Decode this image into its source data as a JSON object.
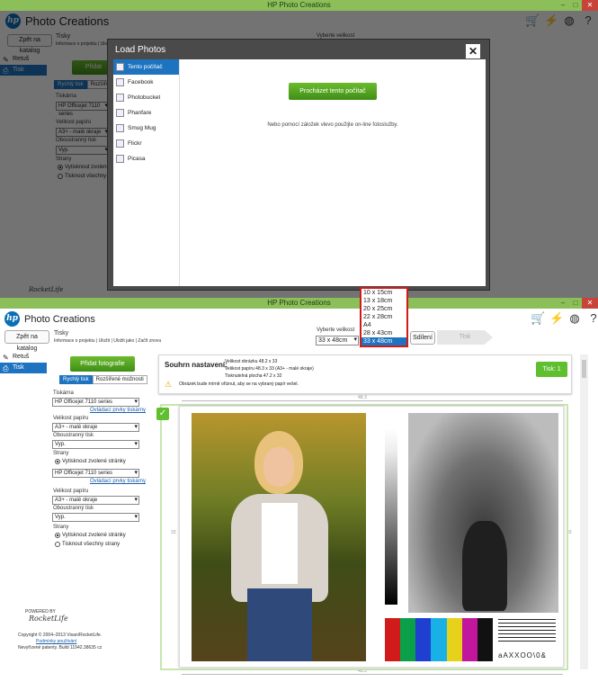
{
  "window_title": "HP Photo Creations",
  "app_name": "Photo Creations",
  "hp_logo": "hp",
  "back_button": "Zpět na katalog",
  "project": {
    "name": "Tisky",
    "links": [
      "Informace o projektu",
      "Uložit",
      "Uložit jako",
      "Začít znovu"
    ]
  },
  "sidebar": [
    {
      "label": "Retuš",
      "icon": "pencil-icon"
    },
    {
      "label": "Tisk",
      "icon": "printer-icon"
    }
  ],
  "add_photo": "Přidat fotografie",
  "tabs": {
    "quick": "Rychlý tisk",
    "advanced": "Rozšířené možnosti"
  },
  "printer": {
    "label": "Tiskárna",
    "value": "HP Officejet 7110 series",
    "link": "Ovládací prvky tiskárny"
  },
  "paper": {
    "label": "Velikost papíru",
    "value": "A3+ - malé okraje"
  },
  "duplex": {
    "label": "Oboustranný tisk",
    "value": "Vyp."
  },
  "pages": {
    "label": "Strany",
    "opt1": "Vytisknout zvolené stránky",
    "opt2": "Tisknout všechny strany"
  },
  "size": {
    "label": "Vyberte velikost",
    "value": "33 x 48cm",
    "options": [
      "10 x 15cm",
      "13 x 18cm",
      "20 x 25cm",
      "22 x 28cm",
      "A4",
      "28 x 43cm",
      "33 x 48cm"
    ],
    "selected_index": 6
  },
  "share_button": "Sdílení",
  "print_button": "Tisk",
  "summary": {
    "title": "Souhrn nastavení:",
    "line1": "Velikost obrázku 48.2 x 33",
    "line2": "Velikost papíru 48.3 x 33 (A3+ - malé okraje)",
    "line3": "Tisknutelná plocha 47.2 x 32",
    "warning": "Obrázek bude mírně oříznut, aby se na vybraný papír vešel."
  },
  "print_count": "Tisk: 1",
  "dims": {
    "width": "48.3",
    "height": "33"
  },
  "footer": {
    "copyright": "Copyright © 2004–2013 Visan/RocketLife.",
    "terms": "Podmínky používání",
    "patents": "Nevyřízené patenty. Build 11942.38635 cz"
  },
  "brand": "RocketLife",
  "brand_note": "POWERED BY",
  "test_chart": {
    "text": "aAXXOO\\0&",
    "colors": [
      "#d11a1a",
      "#0aa04a",
      "#1f3fd1",
      "#19b0e6",
      "#e6d21a",
      "#c2169c",
      "#111111"
    ]
  },
  "dialog": {
    "title": "Load Photos",
    "sources": [
      "Tento počítač",
      "Facebook",
      "Photobucket",
      "Phanfare",
      "Smug Mug",
      "Flickr",
      "Picasa"
    ],
    "source_icons": [
      "computer-icon",
      "facebook-icon",
      "photobucket-icon",
      "phanfare-icon",
      "smugmug-icon",
      "flickr-icon",
      "picasa-icon"
    ],
    "browse": "Procházet tento počítač",
    "hint": "Nebo pomocí záložek vlevo použijte on-line fotoslužby."
  }
}
